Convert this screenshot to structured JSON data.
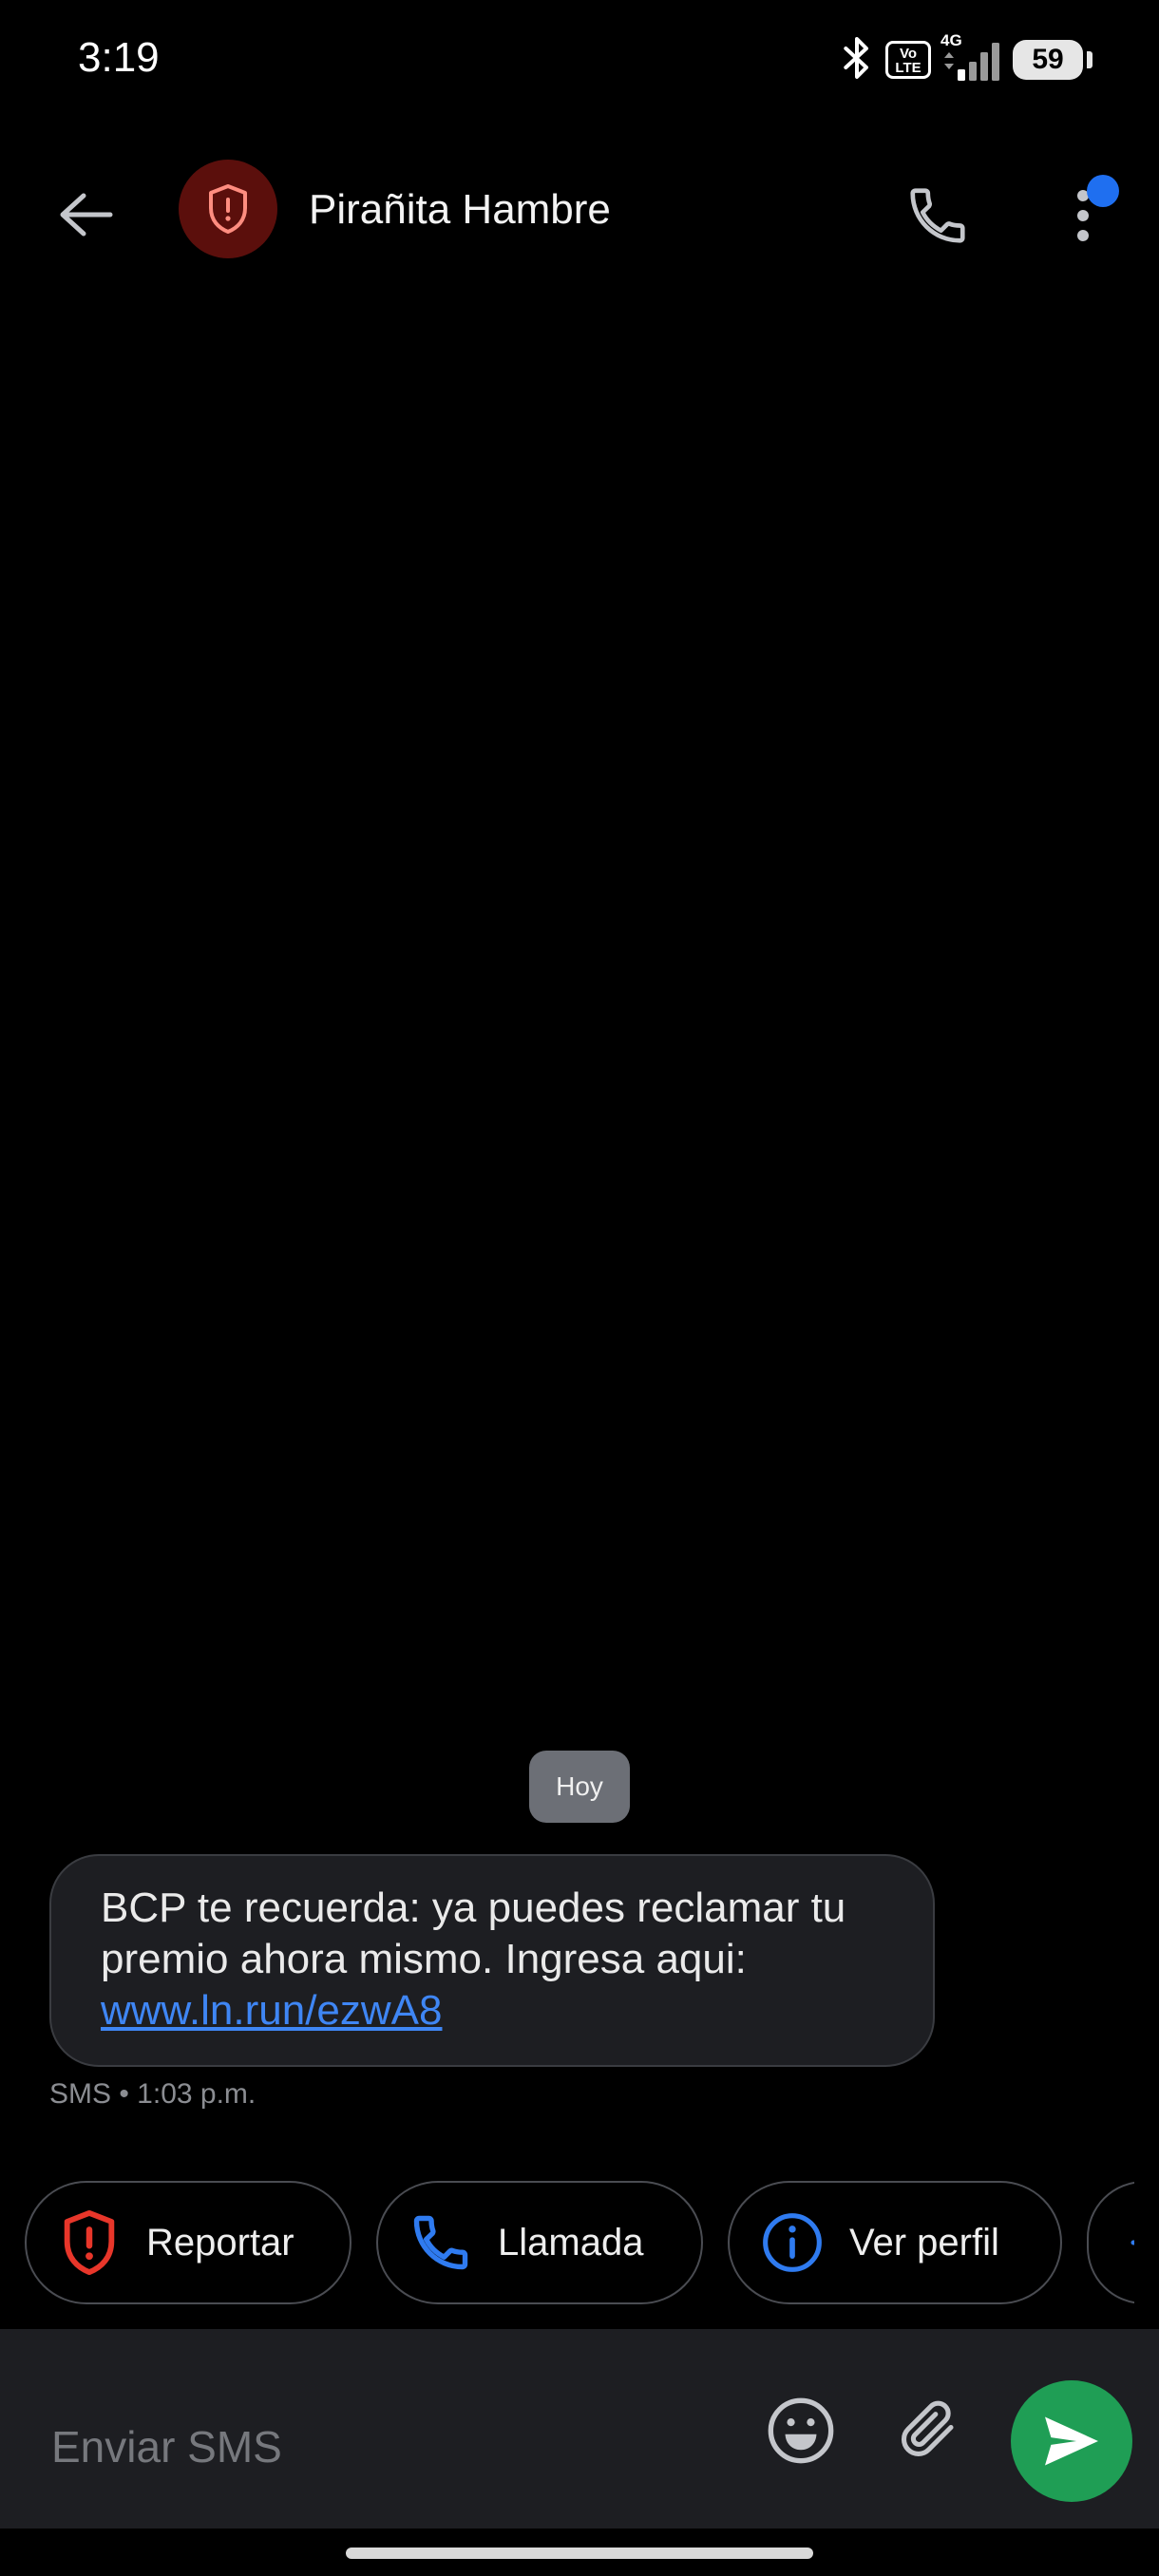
{
  "status_bar": {
    "time": "3:19",
    "volte_top": "Vo",
    "volte_bottom": "LTE",
    "network": "4G",
    "battery": "59"
  },
  "header": {
    "contact_name": "Pirañita Hambre",
    "avatar_icon": "shield-alert-icon"
  },
  "conversation": {
    "date_chip": "Hoy",
    "messages": [
      {
        "text": "BCP te recuerda: ya puedes reclamar tu premio ahora mismo. Ingresa aqui: ",
        "link": "www.ln.run/ezwA8",
        "meta": "SMS • 1:03 p.m."
      }
    ]
  },
  "suggestions": [
    {
      "label": "Reportar",
      "icon": "shield-alert-icon",
      "color": "#e8362a"
    },
    {
      "label": "Llamada",
      "icon": "phone-icon",
      "color": "#2f7bf0"
    },
    {
      "label": "Ver perfil",
      "icon": "info-icon",
      "color": "#2f7bf0"
    },
    {
      "label": "",
      "icon": "plus-icon",
      "color": "#2f7bf0"
    }
  ],
  "compose": {
    "placeholder": "Enviar SMS",
    "value": ""
  },
  "colors": {
    "background": "#000000",
    "accent_blue": "#2f7bf0",
    "send_green": "#1f9e55",
    "warning_red": "#e8362a",
    "avatar_bg": "#5b0f0c"
  }
}
